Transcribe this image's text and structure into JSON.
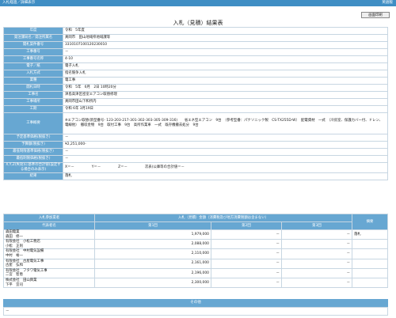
{
  "header": {
    "left": "入札経過／詳細表示",
    "right": "英語版"
  },
  "print_button": "画面印刷",
  "title": "入札（見積）結果表",
  "info_rows": [
    {
      "label": "年度",
      "value": "令和　5年度"
    },
    {
      "label": "発注課局名／発注所属名",
      "value": "真岡市　田山地域県地域課等"
    },
    {
      "label": "開札案件番号",
      "value": "3310107100120230010"
    },
    {
      "label": "工事番号",
      "value": "－"
    },
    {
      "label": "工事番号名称",
      "value": "4-10"
    },
    {
      "label": "電子／紙",
      "value": "電子入札"
    },
    {
      "label": "入札方式",
      "value": "指名競争入札"
    },
    {
      "label": "業種",
      "value": "電工事"
    },
    {
      "label": "開札日時",
      "value": "令和　5年　6月　2日 10時20分"
    },
    {
      "label": "工事名",
      "value": "津島高津区密室エアコン取替修理"
    },
    {
      "label": "工事場所",
      "value": "真岡市田山下和所内"
    },
    {
      "label": "工期",
      "value": "令和 6年 3月19日"
    },
    {
      "label": "工事概要",
      "value": "※エアコン取替(新型番号- 123-203-217-301-302-303-305-309-316)　　省エネ型エアコン　9台　（参考型番：パナソニック製　CS-TX255D-W）　配電資材　一式　（冷房室、保護カバー付、ドレン、電線他）　撤収金物　9台　取付工事　9台　高所作業車　一式　既存機撤去処分　9台"
    },
    {
      "label": "予定基準価格(税抜き)",
      "value": "－"
    },
    {
      "label": "予算額(税抜き)",
      "value": "¥2,251,000-"
    },
    {
      "label": "最低制限基準価格(税抜き)",
      "value": "－"
    },
    {
      "label": "最低制限価格(税抜き)",
      "value": "－"
    },
    {
      "label": "X,Y,Z(失効)に基準の合計値(設定する場合のみ表示)",
      "value": "X＝－　　　　　Y＝－　　　　　Z＝－　　　　　次表(公庫等の合計値＝－"
    },
    {
      "label": "結果",
      "value": "落札"
    }
  ],
  "bid_table": {
    "group_header": "入札参加業者",
    "group_header2": "入札（見積）金額（消費税及び地方消費税額は含まない）",
    "remarks_header": "摘要",
    "col_name": "代表者名",
    "rounds": [
      "第1回",
      "第2回",
      "第3回"
    ],
    "rows": [
      {
        "company": "森田電業",
        "rep": "森田　修一",
        "amounts": [
          "1,979,000",
          "－",
          "－"
        ],
        "remark": "落札"
      },
      {
        "company": "有限会社　小松工務店",
        "rep": "小松　正則",
        "amounts": [
          "2,088,000",
          "－",
          "－"
        ],
        "remark": ""
      },
      {
        "company": "有限会社　中村電気設備",
        "rep": "中村　裕一",
        "amounts": [
          "2,110,000",
          "－",
          "－"
        ],
        "remark": ""
      },
      {
        "company": "有限会社　古屋電気工事",
        "rep": "古屋　弘和",
        "amounts": [
          "2,161,000",
          "－",
          "－"
        ],
        "remark": ""
      },
      {
        "company": "有限会社　フタワ電気工事",
        "rep": "二宮　智恵",
        "amounts": [
          "2,196,000",
          "－",
          "－"
        ],
        "remark": ""
      },
      {
        "company": "株式会社　田山興業",
        "rep": "下平　宜司",
        "amounts": [
          "2,300,000",
          "－",
          "－"
        ],
        "remark": ""
      }
    ]
  },
  "other": {
    "header": "その他",
    "value": "－"
  }
}
